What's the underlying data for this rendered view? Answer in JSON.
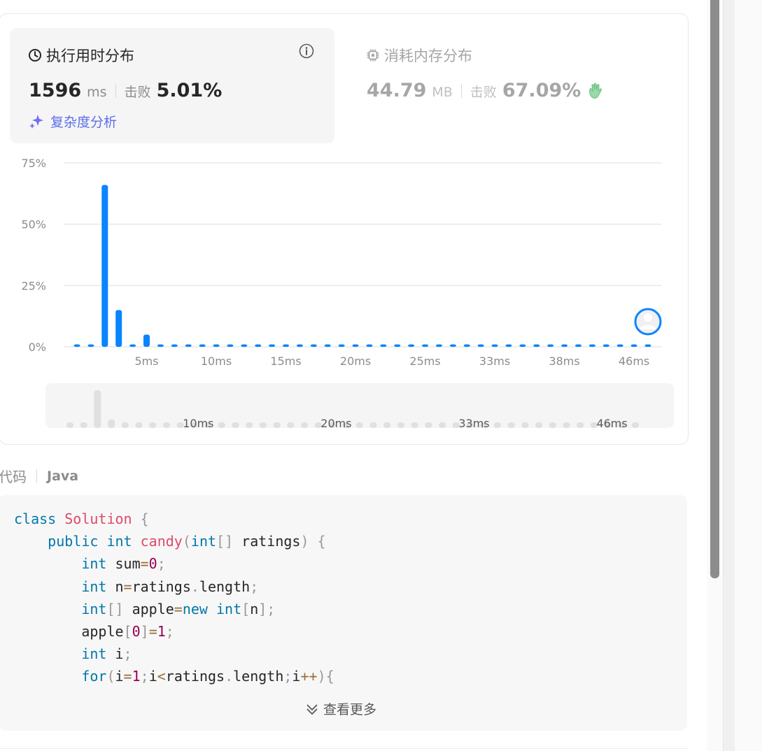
{
  "runtime": {
    "title": "执行用时分布",
    "value": "1596",
    "unit": "ms",
    "beats_label": "击败",
    "beats_value": "5.01%",
    "complexity_link": "复杂度分析"
  },
  "memory": {
    "title": "消耗内存分布",
    "value": "44.79",
    "unit": "MB",
    "beats_label": "击败",
    "beats_value": "67.09%"
  },
  "chart_data": {
    "type": "bar",
    "y_ticks": [
      "75%",
      "50%",
      "25%",
      "0%"
    ],
    "ylim": [
      0,
      75
    ],
    "x_ticks": [
      "5ms",
      "10ms",
      "15ms",
      "20ms",
      "25ms",
      "33ms",
      "38ms",
      "46ms"
    ],
    "values": [
      1,
      1,
      66,
      15,
      1,
      5,
      1,
      1,
      1,
      1,
      1,
      1,
      1,
      1,
      1,
      1,
      1,
      1,
      1,
      1,
      1,
      1,
      1,
      1,
      1,
      1,
      1,
      1,
      1,
      1,
      1,
      1,
      1,
      1,
      1,
      1,
      1,
      1,
      1,
      1,
      1,
      1
    ],
    "color": "#0a84ff",
    "grid": true,
    "minimap_ticks": [
      "10ms",
      "20ms",
      "33ms",
      "46ms"
    ]
  },
  "code_section": {
    "label": "代码",
    "language": "Java",
    "show_more": "查看更多"
  },
  "colors": {
    "accent": "#0a84ff",
    "link": "#5b6ee8",
    "keyword": "#0077aa",
    "function": "#dd4a68",
    "number": "#990055",
    "operator": "#9a6e3a"
  },
  "code_lines": [
    [
      [
        "kw",
        "class"
      ],
      [
        "p",
        " "
      ],
      [
        "fn",
        "Solution"
      ],
      [
        "p",
        " "
      ],
      [
        "pu",
        "{"
      ]
    ],
    [
      [
        "p",
        "    "
      ],
      [
        "kw",
        "public"
      ],
      [
        "p",
        " "
      ],
      [
        "kw",
        "int"
      ],
      [
        "p",
        " "
      ],
      [
        "fn",
        "candy"
      ],
      [
        "pu",
        "("
      ],
      [
        "kw",
        "int"
      ],
      [
        "pu",
        "[]"
      ],
      [
        "p",
        " ratings"
      ],
      [
        "pu",
        ")"
      ],
      [
        "p",
        " "
      ],
      [
        "pu",
        "{"
      ]
    ],
    [
      [
        "p",
        "        "
      ],
      [
        "kw",
        "int"
      ],
      [
        "p",
        " sum"
      ],
      [
        "op",
        "="
      ],
      [
        "num",
        "0"
      ],
      [
        "pu",
        ";"
      ]
    ],
    [
      [
        "p",
        "        "
      ],
      [
        "kw",
        "int"
      ],
      [
        "p",
        " n"
      ],
      [
        "op",
        "="
      ],
      [
        "p",
        "ratings"
      ],
      [
        "pu",
        "."
      ],
      [
        "p",
        "length"
      ],
      [
        "pu",
        ";"
      ]
    ],
    [
      [
        "p",
        "        "
      ],
      [
        "kw",
        "int"
      ],
      [
        "pu",
        "[]"
      ],
      [
        "p",
        " apple"
      ],
      [
        "op",
        "="
      ],
      [
        "kw",
        "new"
      ],
      [
        "p",
        " "
      ],
      [
        "kw",
        "int"
      ],
      [
        "pu",
        "["
      ],
      [
        "p",
        "n"
      ],
      [
        "pu",
        "];"
      ]
    ],
    [
      [
        "p",
        "        apple"
      ],
      [
        "pu",
        "["
      ],
      [
        "num",
        "0"
      ],
      [
        "pu",
        "]"
      ],
      [
        "op",
        "="
      ],
      [
        "num",
        "1"
      ],
      [
        "pu",
        ";"
      ]
    ],
    [
      [
        "p",
        "        "
      ],
      [
        "kw",
        "int"
      ],
      [
        "p",
        " i"
      ],
      [
        "pu",
        ";"
      ]
    ],
    [
      [
        "p",
        "        "
      ],
      [
        "kw",
        "for"
      ],
      [
        "pu",
        "("
      ],
      [
        "p",
        "i"
      ],
      [
        "op",
        "="
      ],
      [
        "num",
        "1"
      ],
      [
        "pu",
        ";"
      ],
      [
        "p",
        "i"
      ],
      [
        "op",
        "<"
      ],
      [
        "p",
        "ratings"
      ],
      [
        "pu",
        "."
      ],
      [
        "p",
        "length"
      ],
      [
        "pu",
        ";"
      ],
      [
        "p",
        "i"
      ],
      [
        "op",
        "++"
      ],
      [
        "pu",
        "){"
      ]
    ]
  ]
}
